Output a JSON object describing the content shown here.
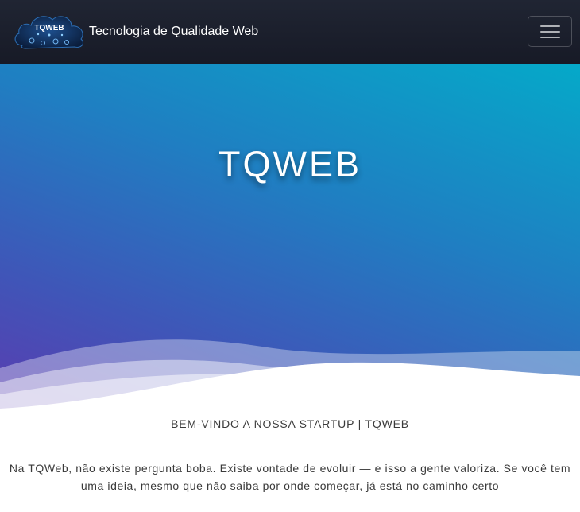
{
  "navbar": {
    "logo_text": "TQWEB",
    "brand_text": "Tecnologia de Qualidade Web",
    "menu_icon": "hamburger-menu-icon"
  },
  "hero": {
    "title": "TQWEB"
  },
  "content": {
    "subtitle": "BEM-VINDO A NOSSA STARTUP | TQWEB",
    "intro": "Na TQWeb, não existe pergunta boba. Existe vontade de evoluir — e isso a gente valoriza. Se você tem uma ideia, mesmo que não saiba por onde começar, já está no caminho certo"
  },
  "colors": {
    "navbar_bg": "#1b1f2c",
    "hero_gradient_start": "#05a9c9",
    "hero_gradient_end": "#5a3cb0",
    "text_dark": "#3a3a3a"
  }
}
